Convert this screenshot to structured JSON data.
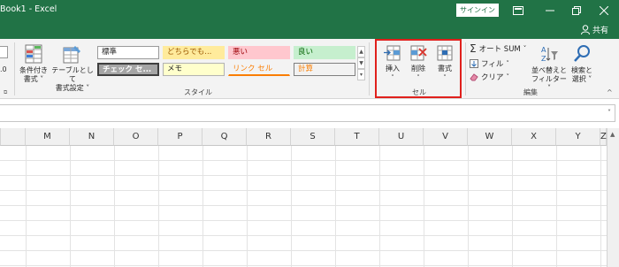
{
  "window": {
    "title": "Book1  -  Excel",
    "signin_label": "サインイン",
    "share_label": "共有"
  },
  "ribbon": {
    "conditional_format_label": [
      "条件付き",
      "書式"
    ],
    "format_as_table_label": [
      "テーブルとして",
      "書式設定"
    ],
    "cell_styles": [
      {
        "label": "標準",
        "bg": "#ffffff",
        "color": "#262626",
        "border": "#9a9a9a"
      },
      {
        "label": "どちらでも...",
        "bg": "#ffeb9c",
        "color": "#9c5700",
        "border": "#ffeb9c"
      },
      {
        "label": "悪い",
        "bg": "#ffc7ce",
        "color": "#9c0006",
        "border": "#ffc7ce"
      },
      {
        "label": "良い",
        "bg": "#c6efce",
        "color": "#006100",
        "border": "#c6efce"
      },
      {
        "label": "チェック セ...",
        "bg": "#a5a5a5",
        "color": "#ffffff",
        "border": "#3f3f3f"
      },
      {
        "label": "メモ",
        "bg": "#ffffcc",
        "color": "#262626",
        "border": "#b2b2b2"
      },
      {
        "label": "リンク セル",
        "bg": "#f3f3f3",
        "color": "#fa7d00",
        "border": "#f3f3f3"
      },
      {
        "label": "計算",
        "bg": "#f2f2f2",
        "color": "#fa7d00",
        "border": "#7f7f7f"
      }
    ],
    "styles_group_label": "スタイル",
    "cells_group": {
      "insert_label": "挿入",
      "delete_label": "削除",
      "format_label": "書式",
      "group_label": "セル"
    },
    "editing_group": {
      "autosum_label": "オート SUM",
      "fill_label": "フィル",
      "clear_label": "クリア",
      "sort_filter_label": [
        "並べ替えと",
        "フィルター"
      ],
      "find_select_label": [
        "検索と",
        "選択"
      ],
      "group_label": "編集"
    }
  },
  "columns": [
    "M",
    "N",
    "O",
    "P",
    "Q",
    "R",
    "S",
    "T",
    "U",
    "V",
    "W",
    "X",
    "Y",
    "Z"
  ],
  "colors": {
    "excel_green": "#217346",
    "highlight_red": "#e0201c"
  }
}
